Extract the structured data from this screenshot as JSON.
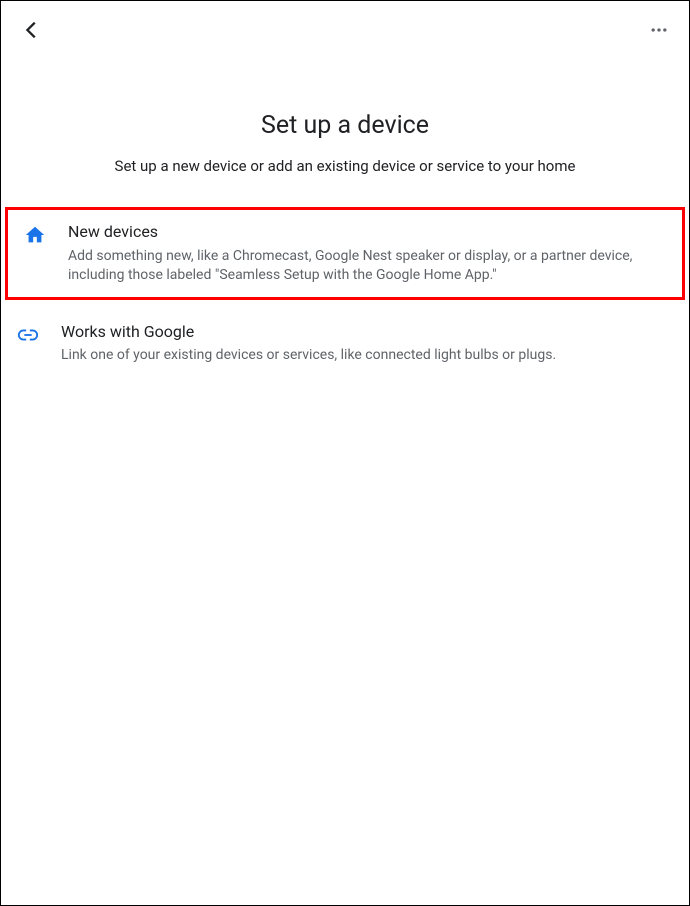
{
  "header": {
    "title": "Set up a device",
    "subtitle": "Set up a new device or add an existing device or service to your home"
  },
  "options": {
    "new_devices": {
      "title": "New devices",
      "desc": "Add something new, like a Chromecast, Google Nest speaker or display, or a partner device, including those labeled \"Seamless Setup with the Google Home App.\""
    },
    "works_with_google": {
      "title": "Works with Google",
      "desc": "Link one of your existing devices or services, like connected light bulbs or plugs."
    }
  },
  "colors": {
    "icon_blue": "#1a73e8",
    "highlight_red": "#ff0000"
  }
}
